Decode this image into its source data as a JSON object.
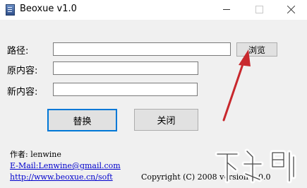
{
  "window": {
    "title": "Beoxue v1.0",
    "controls": [
      "minimize",
      "maximize",
      "close"
    ]
  },
  "form": {
    "path_label": "路径:",
    "path_value": "",
    "browse_label": "浏览",
    "original_label": "原内容:",
    "original_value": "",
    "new_label": "新内容:",
    "new_value": ""
  },
  "actions": {
    "replace_label": "替换",
    "close_label": "关闭"
  },
  "footer": {
    "author": "作者: lenwine",
    "email": "E-Mail:Lenwine@gmail.com",
    "website": "http://www.beoxue.cn/soft",
    "copyright": "Copyright (C) 2008 version 1.0.0"
  },
  "annotation": {
    "arrow_color": "#c8282d"
  },
  "watermark": {
    "text": "下载吧"
  }
}
